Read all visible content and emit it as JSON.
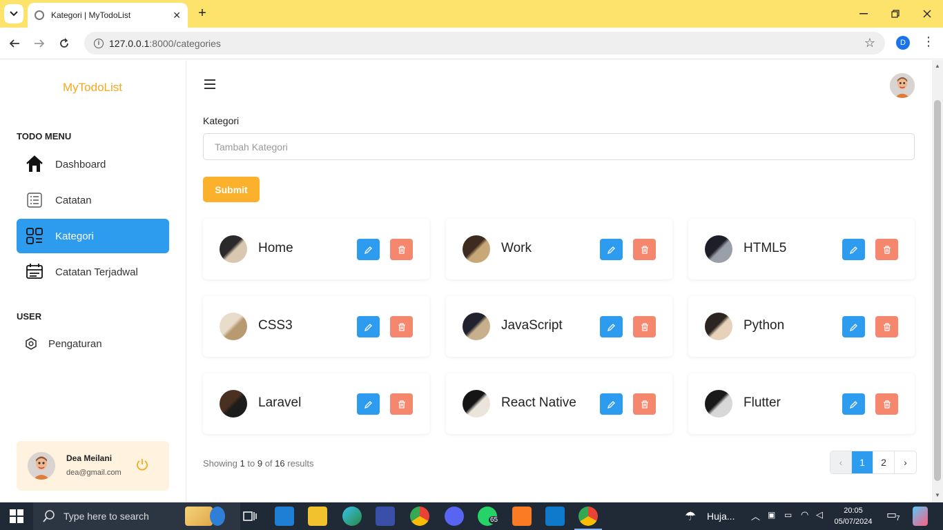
{
  "browser": {
    "tab_title": "Kategori | MyTodoList",
    "url_host": "127.0.0.1",
    "url_rest": ":8000/categories",
    "profile_initial": "D"
  },
  "sidebar": {
    "brand": "MyTodoList",
    "todo_menu_title": "TODO MENU",
    "items": [
      {
        "label": "Dashboard",
        "icon": "home-icon"
      },
      {
        "label": "Catatan",
        "icon": "notes-icon"
      },
      {
        "label": "Kategori",
        "icon": "category-grid-icon",
        "active": true
      },
      {
        "label": "Catatan Terjadwal",
        "icon": "calendar-icon"
      }
    ],
    "user_section_title": "USER",
    "settings_label": "Pengaturan",
    "user": {
      "name": "Dea Meilani",
      "email": "dea@gmail.com"
    }
  },
  "form": {
    "label": "Kategori",
    "placeholder": "Tambah Kategori",
    "submit_label": "Submit"
  },
  "categories": [
    {
      "name": "Home"
    },
    {
      "name": "Work"
    },
    {
      "name": "HTML5"
    },
    {
      "name": "CSS3"
    },
    {
      "name": "JavaScript"
    },
    {
      "name": "Python"
    },
    {
      "name": "Laravel"
    },
    {
      "name": "React Native"
    },
    {
      "name": "Flutter"
    }
  ],
  "pagination": {
    "showing_prefix": "Showing",
    "from": "1",
    "to_word": "to",
    "to": "9",
    "of_word": "of",
    "total": "16",
    "results_word": "results",
    "prev": "‹",
    "pages": [
      "1",
      "2"
    ],
    "next": "›",
    "current": "1"
  },
  "taskbar": {
    "search_placeholder": "Type here to search",
    "weather_text": "Huja...",
    "time": "20:05",
    "date": "05/07/2024",
    "whatsapp_badge": "65",
    "notification_count": "7"
  },
  "colors": {
    "accent_blue": "#2d9cef",
    "accent_orange": "#fbb12b",
    "delete_red": "#f4876d",
    "brand_orange": "#f7a81b",
    "titlebar_yellow": "#fde26c"
  }
}
